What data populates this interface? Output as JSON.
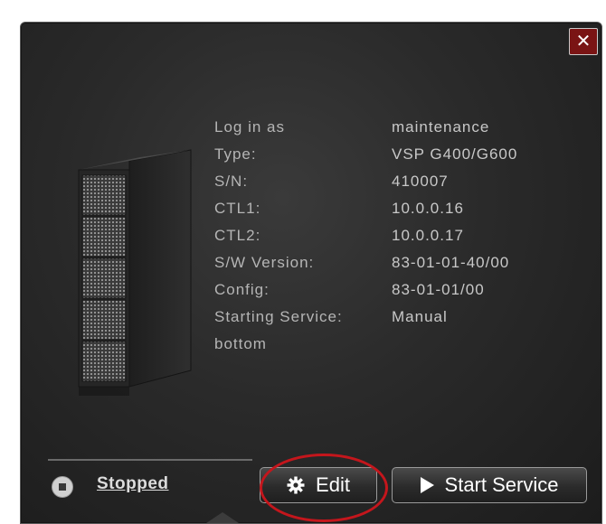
{
  "dialog": {
    "close_label": "✕"
  },
  "info": {
    "rows": [
      {
        "label": "Log in as",
        "value": "maintenance"
      },
      {
        "label": "Type:",
        "value": "VSP G400/G600"
      },
      {
        "label": "S/N:",
        "value": "410007"
      },
      {
        "label": "CTL1:",
        "value": "10.0.0.16"
      },
      {
        "label": "CTL2:",
        "value": "10.0.0.17"
      },
      {
        "label": "S/W Version:",
        "value": "83-01-01-40/00"
      },
      {
        "label": "Config:",
        "value": "83-01-01/00"
      },
      {
        "label": "Starting Service:",
        "value": "Manual"
      },
      {
        "label": "bottom",
        "value": ""
      }
    ]
  },
  "status": {
    "text": "Stopped"
  },
  "buttons": {
    "edit_label": "Edit",
    "start_label": "Start Service"
  },
  "colors": {
    "panel_bg": "#2a2a2a",
    "close_bg": "#7a1414",
    "highlight": "#c4161c"
  },
  "icons": {
    "close": "close-icon",
    "server": "server-storage-icon",
    "status": "stop-status-icon",
    "edit": "gear-icon",
    "start": "play-icon"
  }
}
